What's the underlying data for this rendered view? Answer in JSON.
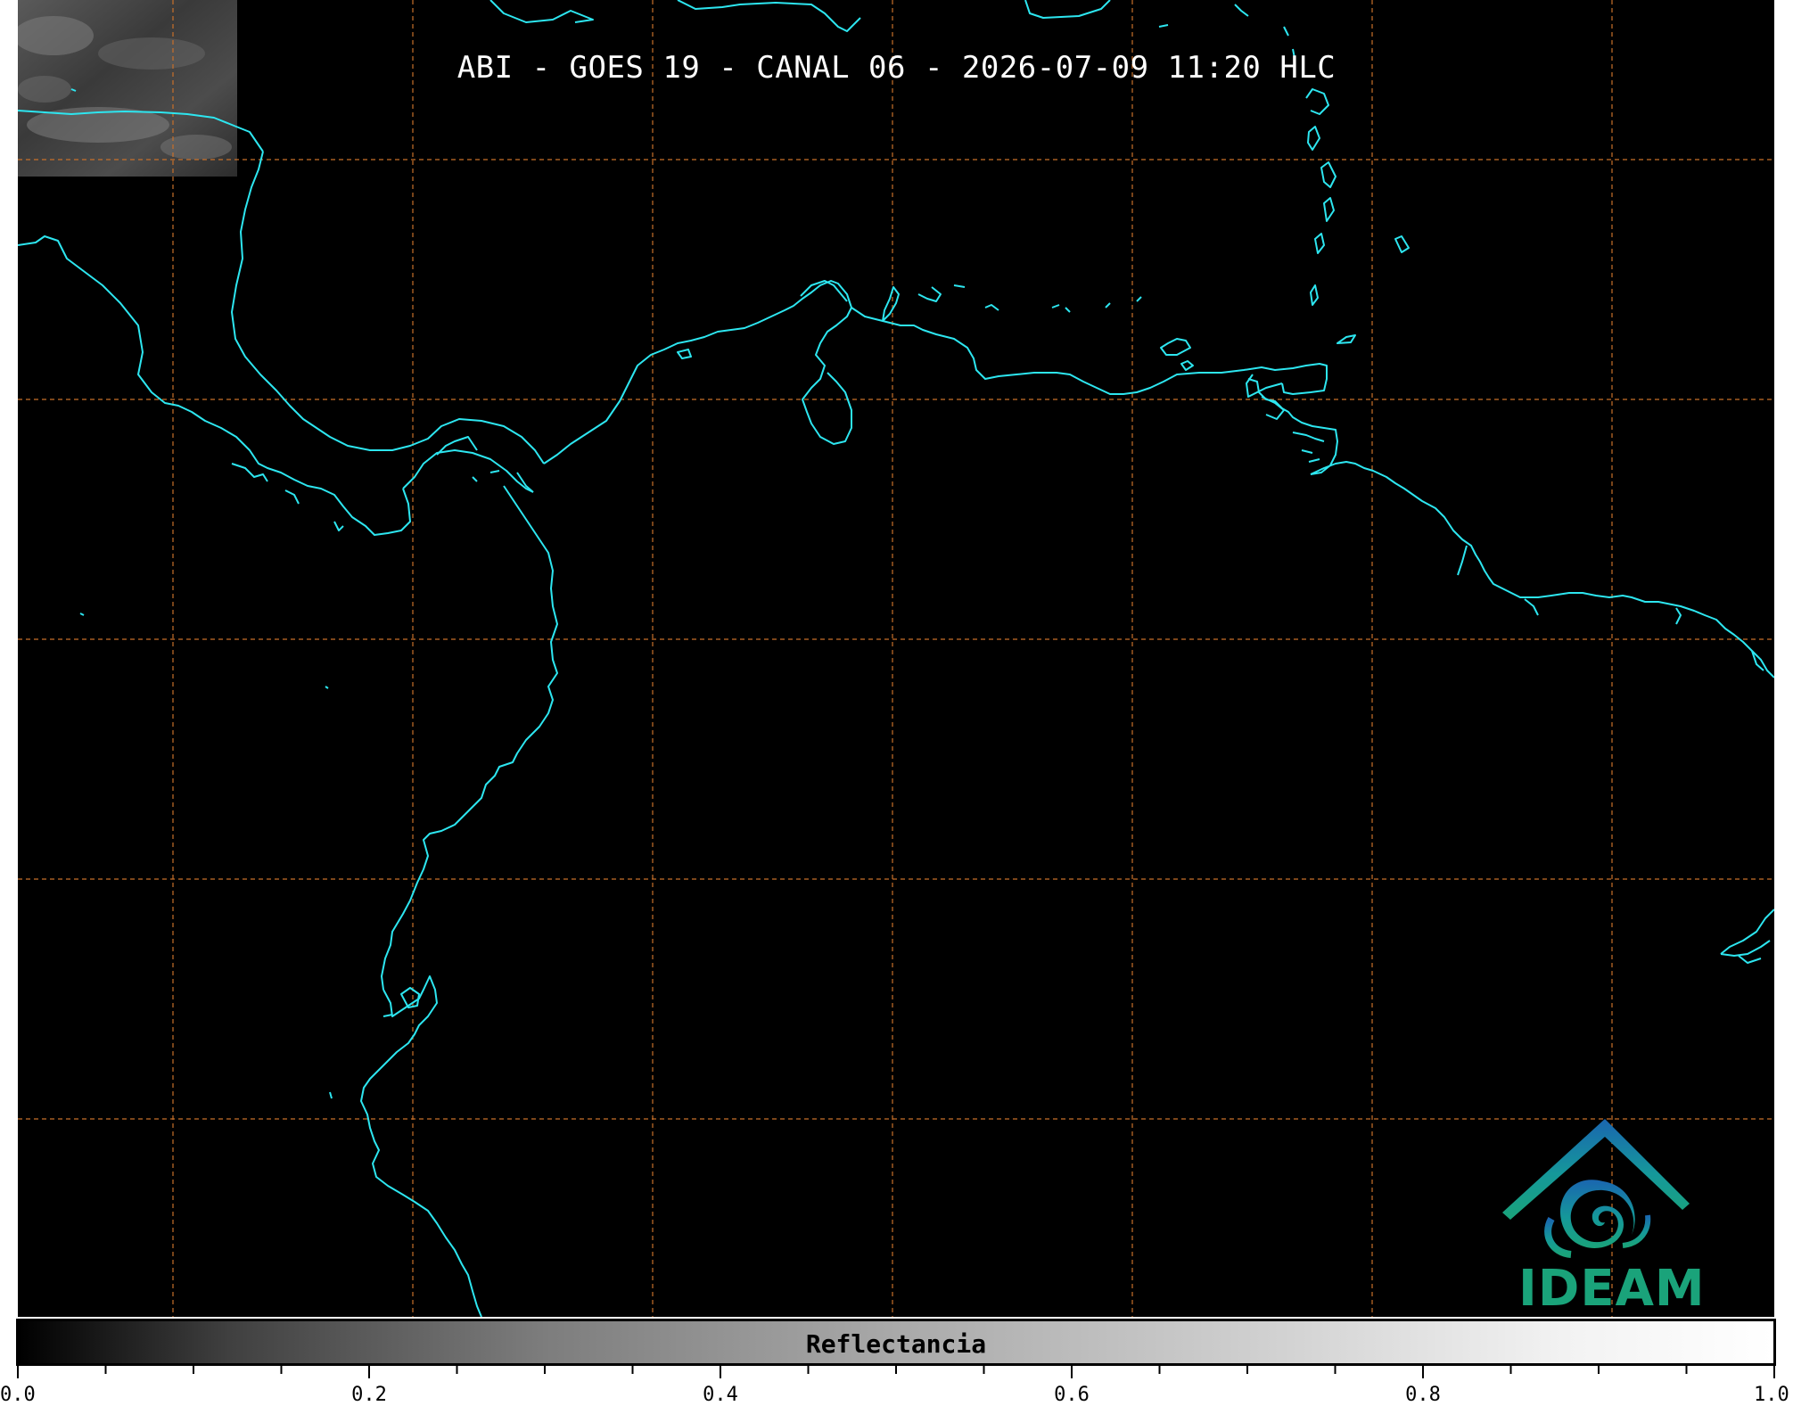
{
  "map": {
    "title": "ABI - GOES 19 - CANAL 06 - 2026-07-09 11:20 HLC",
    "coastline_color": "#2de6f0",
    "gridline_color": "#c8702a",
    "background_color": "#000000"
  },
  "logo": {
    "text": "IDEAM",
    "icon": "ideam-logo-icon",
    "color": "#1aa37a"
  },
  "colorbar": {
    "label": "Reflectancia",
    "colormap": "greys",
    "range": [
      0.0,
      1.0
    ],
    "tick_labels": [
      "0.0",
      "0.2",
      "0.4",
      "0.6",
      "0.8",
      "1.0"
    ],
    "tick_values": [
      0.0,
      0.2,
      0.4,
      0.6,
      0.8,
      1.0
    ]
  }
}
